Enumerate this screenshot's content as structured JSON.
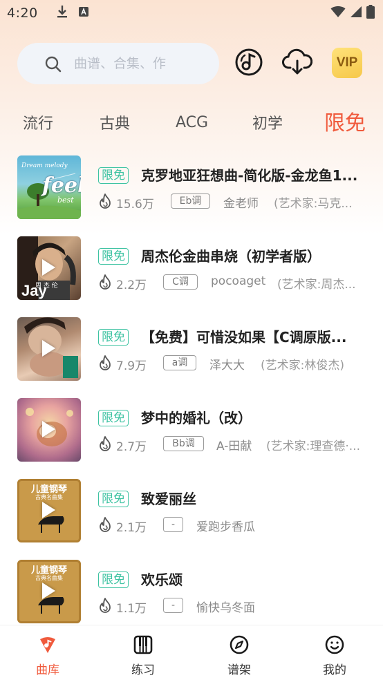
{
  "status_bar": {
    "time": "4:20"
  },
  "search": {
    "placeholder": "曲谱、合集、作"
  },
  "header": {
    "vip_label": "VIP"
  },
  "tabs": [
    {
      "label": "流行",
      "active": false
    },
    {
      "label": "古典",
      "active": false
    },
    {
      "label": "ACG",
      "active": false
    },
    {
      "label": "初学",
      "active": false
    },
    {
      "label": "限免",
      "active": true
    }
  ],
  "songs": [
    {
      "badge": "限免",
      "title": "克罗地亚狂想曲-简化版-金龙鱼1...",
      "plays": "15.6万",
      "key": "Eb调",
      "author": "金老师",
      "artist": "(艺术家:马克..."
    },
    {
      "badge": "限免",
      "title": "周杰伦金曲串烧（初学者版）",
      "plays": "2.2万",
      "key": "C调",
      "author": "pocoaget",
      "artist": "(艺术家:周杰..."
    },
    {
      "badge": "限免",
      "title": "【免费】可惜没如果【C调原版...",
      "plays": "7.9万",
      "key": "a调",
      "author": "泽大大",
      "artist": "(艺术家:林俊杰)"
    },
    {
      "badge": "限免",
      "title": "梦中的婚礼（改）",
      "plays": "2.7万",
      "key": "Bb调",
      "author": "A-田献",
      "artist": "(艺术家:理查德·..."
    },
    {
      "badge": "限免",
      "title": "致爱丽丝",
      "plays": "2.1万",
      "key": "-",
      "author": "爱跑步香瓜",
      "artist": ""
    },
    {
      "badge": "限免",
      "title": "欢乐颂",
      "plays": "1.1万",
      "key": "-",
      "author": "愉快乌冬面",
      "artist": ""
    }
  ],
  "covers": [
    {
      "line1": "Dream melody",
      "line2": "feel",
      "line3": "best"
    },
    {
      "line1": "周 杰 伦",
      "line2": "Jay"
    },
    {
      "line1": ""
    },
    {
      "line1": ""
    },
    {
      "line1": "儿童钢琴",
      "line2": "古典名曲集"
    },
    {
      "line1": "儿童钢琴",
      "line2": "古典名曲集"
    }
  ],
  "bottom_nav": [
    {
      "label": "曲库",
      "icon": "library-icon",
      "active": true
    },
    {
      "label": "练习",
      "icon": "piano-icon",
      "active": false
    },
    {
      "label": "谱架",
      "icon": "compass-icon",
      "active": false
    },
    {
      "label": "我的",
      "icon": "smile-icon",
      "active": false
    }
  ],
  "colors": {
    "accent": "#f05a3c",
    "free_badge": "#3ec3a2",
    "vip_gold": "#f6c84a"
  }
}
